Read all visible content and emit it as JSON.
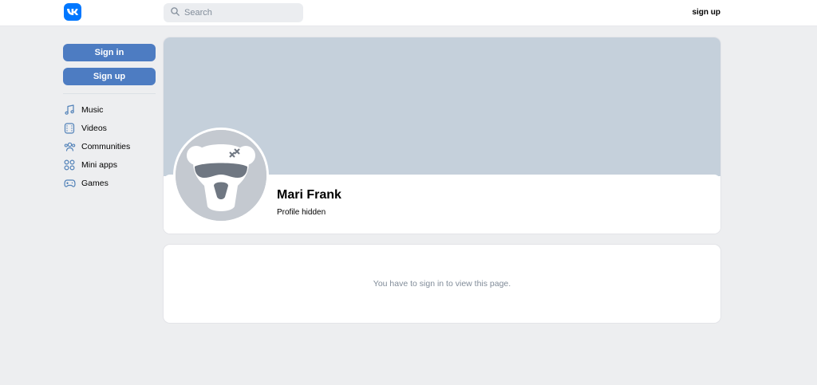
{
  "header": {
    "search_placeholder": "Search",
    "signup_link": "sign up"
  },
  "sidebar": {
    "signin_label": "Sign in",
    "signup_label": "Sign up",
    "items": [
      {
        "label": "Music",
        "icon": "music-icon"
      },
      {
        "label": "Videos",
        "icon": "video-icon"
      },
      {
        "label": "Communities",
        "icon": "communities-icon"
      },
      {
        "label": "Mini apps",
        "icon": "mini-apps-icon"
      },
      {
        "label": "Games",
        "icon": "gamepad-icon"
      }
    ]
  },
  "profile": {
    "name": "Mari Frank",
    "status": "Profile hidden"
  },
  "message": {
    "text": "You have to sign in to view this page."
  },
  "colors": {
    "brand": "#0077ff",
    "button": "#4d7cc2",
    "cover": "#c5d0db",
    "page_bg": "#edeef0"
  }
}
